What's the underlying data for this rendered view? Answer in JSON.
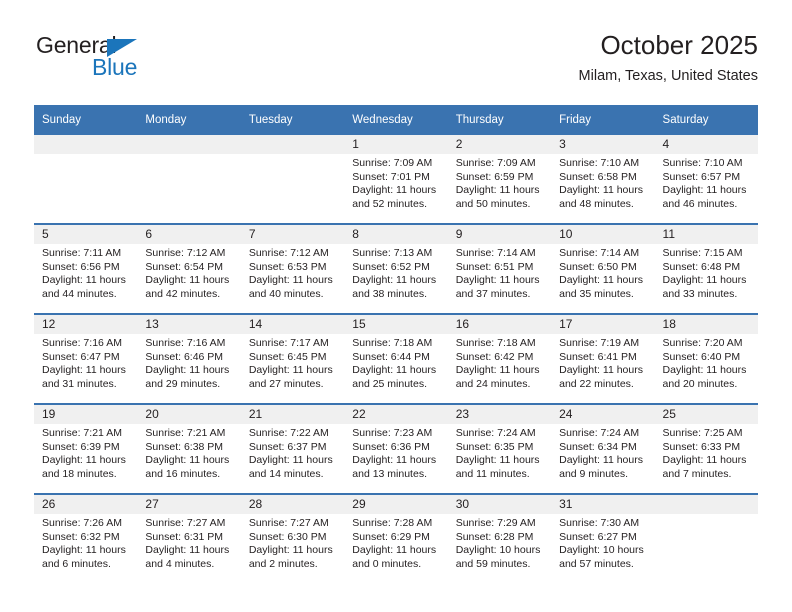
{
  "brand": {
    "name_dark": "General",
    "name_blue": "Blue",
    "accent_color": "#1b75bb"
  },
  "header": {
    "title": "October 2025",
    "location": "Milam, Texas, United States",
    "header_bg": "#3a73b0",
    "band_bg": "#f0f0f0"
  },
  "weekday_headers": [
    "Sunday",
    "Monday",
    "Tuesday",
    "Wednesday",
    "Thursday",
    "Friday",
    "Saturday"
  ],
  "weeks": [
    [
      {
        "day": "",
        "sunrise": "",
        "sunset": "",
        "daylight_line1": "",
        "daylight_line2": ""
      },
      {
        "day": "",
        "sunrise": "",
        "sunset": "",
        "daylight_line1": "",
        "daylight_line2": ""
      },
      {
        "day": "",
        "sunrise": "",
        "sunset": "",
        "daylight_line1": "",
        "daylight_line2": ""
      },
      {
        "day": "1",
        "sunrise": "Sunrise: 7:09 AM",
        "sunset": "Sunset: 7:01 PM",
        "daylight_line1": "Daylight: 11 hours",
        "daylight_line2": "and 52 minutes."
      },
      {
        "day": "2",
        "sunrise": "Sunrise: 7:09 AM",
        "sunset": "Sunset: 6:59 PM",
        "daylight_line1": "Daylight: 11 hours",
        "daylight_line2": "and 50 minutes."
      },
      {
        "day": "3",
        "sunrise": "Sunrise: 7:10 AM",
        "sunset": "Sunset: 6:58 PM",
        "daylight_line1": "Daylight: 11 hours",
        "daylight_line2": "and 48 minutes."
      },
      {
        "day": "4",
        "sunrise": "Sunrise: 7:10 AM",
        "sunset": "Sunset: 6:57 PM",
        "daylight_line1": "Daylight: 11 hours",
        "daylight_line2": "and 46 minutes."
      }
    ],
    [
      {
        "day": "5",
        "sunrise": "Sunrise: 7:11 AM",
        "sunset": "Sunset: 6:56 PM",
        "daylight_line1": "Daylight: 11 hours",
        "daylight_line2": "and 44 minutes."
      },
      {
        "day": "6",
        "sunrise": "Sunrise: 7:12 AM",
        "sunset": "Sunset: 6:54 PM",
        "daylight_line1": "Daylight: 11 hours",
        "daylight_line2": "and 42 minutes."
      },
      {
        "day": "7",
        "sunrise": "Sunrise: 7:12 AM",
        "sunset": "Sunset: 6:53 PM",
        "daylight_line1": "Daylight: 11 hours",
        "daylight_line2": "and 40 minutes."
      },
      {
        "day": "8",
        "sunrise": "Sunrise: 7:13 AM",
        "sunset": "Sunset: 6:52 PM",
        "daylight_line1": "Daylight: 11 hours",
        "daylight_line2": "and 38 minutes."
      },
      {
        "day": "9",
        "sunrise": "Sunrise: 7:14 AM",
        "sunset": "Sunset: 6:51 PM",
        "daylight_line1": "Daylight: 11 hours",
        "daylight_line2": "and 37 minutes."
      },
      {
        "day": "10",
        "sunrise": "Sunrise: 7:14 AM",
        "sunset": "Sunset: 6:50 PM",
        "daylight_line1": "Daylight: 11 hours",
        "daylight_line2": "and 35 minutes."
      },
      {
        "day": "11",
        "sunrise": "Sunrise: 7:15 AM",
        "sunset": "Sunset: 6:48 PM",
        "daylight_line1": "Daylight: 11 hours",
        "daylight_line2": "and 33 minutes."
      }
    ],
    [
      {
        "day": "12",
        "sunrise": "Sunrise: 7:16 AM",
        "sunset": "Sunset: 6:47 PM",
        "daylight_line1": "Daylight: 11 hours",
        "daylight_line2": "and 31 minutes."
      },
      {
        "day": "13",
        "sunrise": "Sunrise: 7:16 AM",
        "sunset": "Sunset: 6:46 PM",
        "daylight_line1": "Daylight: 11 hours",
        "daylight_line2": "and 29 minutes."
      },
      {
        "day": "14",
        "sunrise": "Sunrise: 7:17 AM",
        "sunset": "Sunset: 6:45 PM",
        "daylight_line1": "Daylight: 11 hours",
        "daylight_line2": "and 27 minutes."
      },
      {
        "day": "15",
        "sunrise": "Sunrise: 7:18 AM",
        "sunset": "Sunset: 6:44 PM",
        "daylight_line1": "Daylight: 11 hours",
        "daylight_line2": "and 25 minutes."
      },
      {
        "day": "16",
        "sunrise": "Sunrise: 7:18 AM",
        "sunset": "Sunset: 6:42 PM",
        "daylight_line1": "Daylight: 11 hours",
        "daylight_line2": "and 24 minutes."
      },
      {
        "day": "17",
        "sunrise": "Sunrise: 7:19 AM",
        "sunset": "Sunset: 6:41 PM",
        "daylight_line1": "Daylight: 11 hours",
        "daylight_line2": "and 22 minutes."
      },
      {
        "day": "18",
        "sunrise": "Sunrise: 7:20 AM",
        "sunset": "Sunset: 6:40 PM",
        "daylight_line1": "Daylight: 11 hours",
        "daylight_line2": "and 20 minutes."
      }
    ],
    [
      {
        "day": "19",
        "sunrise": "Sunrise: 7:21 AM",
        "sunset": "Sunset: 6:39 PM",
        "daylight_line1": "Daylight: 11 hours",
        "daylight_line2": "and 18 minutes."
      },
      {
        "day": "20",
        "sunrise": "Sunrise: 7:21 AM",
        "sunset": "Sunset: 6:38 PM",
        "daylight_line1": "Daylight: 11 hours",
        "daylight_line2": "and 16 minutes."
      },
      {
        "day": "21",
        "sunrise": "Sunrise: 7:22 AM",
        "sunset": "Sunset: 6:37 PM",
        "daylight_line1": "Daylight: 11 hours",
        "daylight_line2": "and 14 minutes."
      },
      {
        "day": "22",
        "sunrise": "Sunrise: 7:23 AM",
        "sunset": "Sunset: 6:36 PM",
        "daylight_line1": "Daylight: 11 hours",
        "daylight_line2": "and 13 minutes."
      },
      {
        "day": "23",
        "sunrise": "Sunrise: 7:24 AM",
        "sunset": "Sunset: 6:35 PM",
        "daylight_line1": "Daylight: 11 hours",
        "daylight_line2": "and 11 minutes."
      },
      {
        "day": "24",
        "sunrise": "Sunrise: 7:24 AM",
        "sunset": "Sunset: 6:34 PM",
        "daylight_line1": "Daylight: 11 hours",
        "daylight_line2": "and 9 minutes."
      },
      {
        "day": "25",
        "sunrise": "Sunrise: 7:25 AM",
        "sunset": "Sunset: 6:33 PM",
        "daylight_line1": "Daylight: 11 hours",
        "daylight_line2": "and 7 minutes."
      }
    ],
    [
      {
        "day": "26",
        "sunrise": "Sunrise: 7:26 AM",
        "sunset": "Sunset: 6:32 PM",
        "daylight_line1": "Daylight: 11 hours",
        "daylight_line2": "and 6 minutes."
      },
      {
        "day": "27",
        "sunrise": "Sunrise: 7:27 AM",
        "sunset": "Sunset: 6:31 PM",
        "daylight_line1": "Daylight: 11 hours",
        "daylight_line2": "and 4 minutes."
      },
      {
        "day": "28",
        "sunrise": "Sunrise: 7:27 AM",
        "sunset": "Sunset: 6:30 PM",
        "daylight_line1": "Daylight: 11 hours",
        "daylight_line2": "and 2 minutes."
      },
      {
        "day": "29",
        "sunrise": "Sunrise: 7:28 AM",
        "sunset": "Sunset: 6:29 PM",
        "daylight_line1": "Daylight: 11 hours",
        "daylight_line2": "and 0 minutes."
      },
      {
        "day": "30",
        "sunrise": "Sunrise: 7:29 AM",
        "sunset": "Sunset: 6:28 PM",
        "daylight_line1": "Daylight: 10 hours",
        "daylight_line2": "and 59 minutes."
      },
      {
        "day": "31",
        "sunrise": "Sunrise: 7:30 AM",
        "sunset": "Sunset: 6:27 PM",
        "daylight_line1": "Daylight: 10 hours",
        "daylight_line2": "and 57 minutes."
      },
      {
        "day": "",
        "sunrise": "",
        "sunset": "",
        "daylight_line1": "",
        "daylight_line2": ""
      }
    ]
  ]
}
